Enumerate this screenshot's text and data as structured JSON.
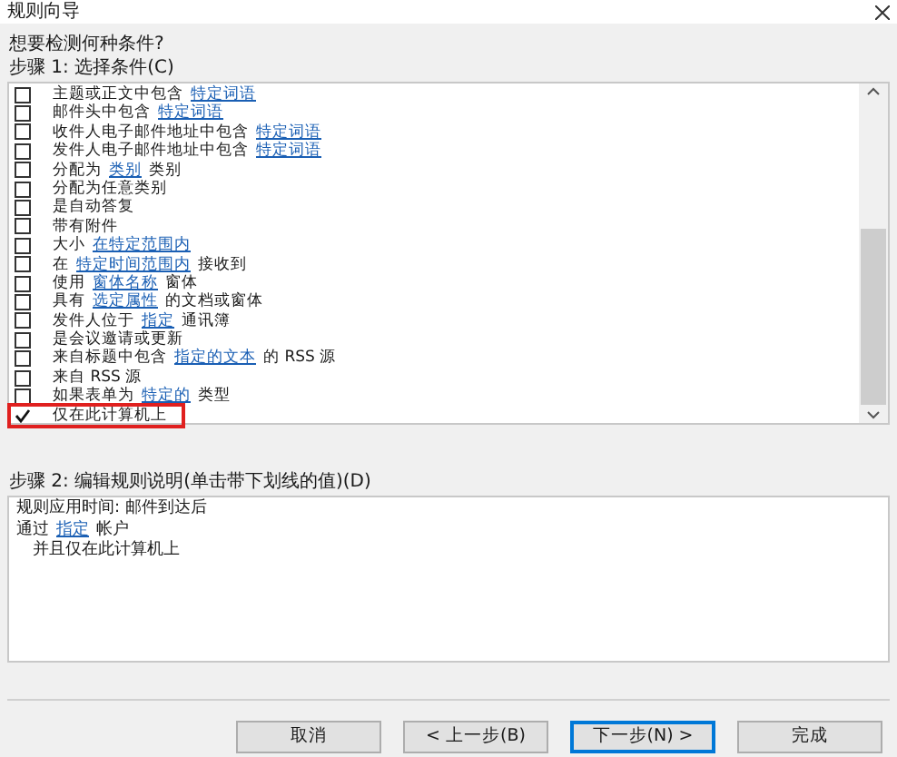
{
  "window": {
    "title": "规则向导"
  },
  "question": "想要检测何种条件?",
  "step1": {
    "label": "步骤 1: 选择条件(C)",
    "conditions": [
      {
        "checked": false,
        "highlighted": false,
        "segments": [
          {
            "kind": "text",
            "text": "主题或正文中包含"
          },
          {
            "kind": "link",
            "text": "特定词语"
          }
        ]
      },
      {
        "checked": false,
        "highlighted": false,
        "segments": [
          {
            "kind": "text",
            "text": "邮件头中包含"
          },
          {
            "kind": "link",
            "text": "特定词语"
          }
        ]
      },
      {
        "checked": false,
        "highlighted": false,
        "segments": [
          {
            "kind": "text",
            "text": "收件人电子邮件地址中包含"
          },
          {
            "kind": "link",
            "text": "特定词语"
          }
        ]
      },
      {
        "checked": false,
        "highlighted": false,
        "segments": [
          {
            "kind": "text",
            "text": "发件人电子邮件地址中包含"
          },
          {
            "kind": "link",
            "text": "特定词语"
          }
        ]
      },
      {
        "checked": false,
        "highlighted": false,
        "segments": [
          {
            "kind": "text",
            "text": "分配为"
          },
          {
            "kind": "link",
            "text": "类别"
          },
          {
            "kind": "text",
            "text": "类别"
          }
        ]
      },
      {
        "checked": false,
        "highlighted": false,
        "segments": [
          {
            "kind": "text",
            "text": "分配为任意类别"
          }
        ]
      },
      {
        "checked": false,
        "highlighted": false,
        "segments": [
          {
            "kind": "text",
            "text": "是自动答复"
          }
        ]
      },
      {
        "checked": false,
        "highlighted": false,
        "segments": [
          {
            "kind": "text",
            "text": "带有附件"
          }
        ]
      },
      {
        "checked": false,
        "highlighted": false,
        "segments": [
          {
            "kind": "text",
            "text": "大小"
          },
          {
            "kind": "link",
            "text": "在特定范围内"
          }
        ]
      },
      {
        "checked": false,
        "highlighted": false,
        "segments": [
          {
            "kind": "text",
            "text": "在"
          },
          {
            "kind": "link",
            "text": "特定时间范围内"
          },
          {
            "kind": "text",
            "text": "接收到"
          }
        ]
      },
      {
        "checked": false,
        "highlighted": false,
        "segments": [
          {
            "kind": "text",
            "text": "使用"
          },
          {
            "kind": "link",
            "text": "窗体名称"
          },
          {
            "kind": "text",
            "text": "窗体"
          }
        ]
      },
      {
        "checked": false,
        "highlighted": false,
        "segments": [
          {
            "kind": "text",
            "text": "具有"
          },
          {
            "kind": "link",
            "text": "选定属性"
          },
          {
            "kind": "text",
            "text": "的文档或窗体"
          }
        ]
      },
      {
        "checked": false,
        "highlighted": false,
        "segments": [
          {
            "kind": "text",
            "text": "发件人位于"
          },
          {
            "kind": "link",
            "text": "指定"
          },
          {
            "kind": "text",
            "text": "通讯簿"
          }
        ]
      },
      {
        "checked": false,
        "highlighted": false,
        "segments": [
          {
            "kind": "text",
            "text": "是会议邀请或更新"
          }
        ]
      },
      {
        "checked": false,
        "highlighted": false,
        "segments": [
          {
            "kind": "text",
            "text": "来自标题中包含"
          },
          {
            "kind": "link",
            "text": "指定的文本"
          },
          {
            "kind": "text",
            "text": "的 RSS 源"
          }
        ]
      },
      {
        "checked": false,
        "highlighted": false,
        "segments": [
          {
            "kind": "text",
            "text": "来自 RSS 源"
          }
        ]
      },
      {
        "checked": false,
        "highlighted": false,
        "segments": [
          {
            "kind": "text",
            "text": "如果表单为"
          },
          {
            "kind": "link",
            "text": "特定的"
          },
          {
            "kind": "text",
            "text": "类型"
          }
        ]
      },
      {
        "checked": true,
        "highlighted": true,
        "segments": [
          {
            "kind": "text",
            "text": "仅在此计算机上"
          }
        ]
      }
    ]
  },
  "step2": {
    "label": "步骤 2: 编辑规则说明(单击带下划线的值)(D)",
    "lines": [
      {
        "indented": false,
        "segments": [
          {
            "kind": "text",
            "text": "规则应用时间: 邮件到达后"
          }
        ]
      },
      {
        "indented": false,
        "segments": [
          {
            "kind": "text",
            "text": "通过"
          },
          {
            "kind": "link",
            "text": "指定"
          },
          {
            "kind": "text",
            "text": "帐户"
          }
        ]
      },
      {
        "indented": true,
        "segments": [
          {
            "kind": "text",
            "text": "并且仅在此计算机上"
          }
        ]
      }
    ]
  },
  "buttons": [
    {
      "label": "取消",
      "default": false
    },
    {
      "label": "< 上一步(B)",
      "default": false
    },
    {
      "label": "下一步(N) >",
      "default": true
    },
    {
      "label": "完成",
      "default": false
    }
  ]
}
